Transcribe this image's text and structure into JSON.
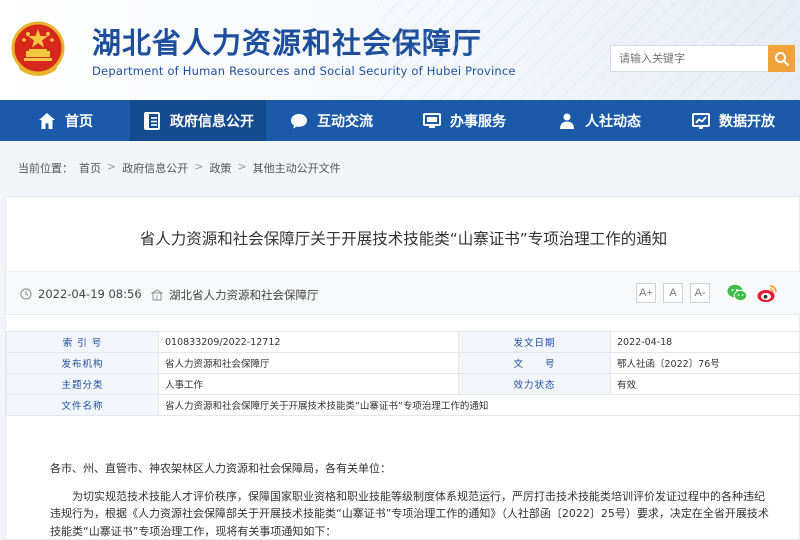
{
  "header": {
    "title": "湖北省人力资源和社会保障厅",
    "subtitle": "Department of Human Resources and Social Security of Hubei Province",
    "search_placeholder": "请输入关键字"
  },
  "nav": [
    {
      "label": "首页",
      "icon": "home-icon"
    },
    {
      "label": "政府信息公开",
      "icon": "document-icon"
    },
    {
      "label": "互动交流",
      "icon": "chat-icon"
    },
    {
      "label": "办事服务",
      "icon": "monitor-icon"
    },
    {
      "label": "人社动态",
      "icon": "person-icon"
    },
    {
      "label": "数据开放",
      "icon": "chart-icon"
    }
  ],
  "nav_active": 1,
  "breadcrumb": {
    "prefix": "当前位置：",
    "items": [
      "首页",
      "政府信息公开",
      "政策",
      "其他主动公开文件"
    ]
  },
  "article": {
    "title": "省人力资源和社会保障厅关于开展技术技能类“山寨证书”专项治理工作的通知",
    "date": "2022-04-19 08:56",
    "source": "湖北省人力资源和社会保障厅",
    "font_buttons": [
      "A+",
      "A",
      "A-"
    ]
  },
  "info": {
    "index_label": "索 引 号",
    "index_value": "010833209/2022-12712",
    "pub_date_label": "发文日期",
    "pub_date_value": "2022-04-18",
    "issuer_label": "发布机构",
    "issuer_value": "省人力资源和社会保障厅",
    "doc_no_label": "文　　号",
    "doc_no_value": "鄂人社函〔2022〕76号",
    "topic_label": "主题分类",
    "topic_value": "人事工作",
    "status_label": "效力状态",
    "status_value": "有效",
    "name_label": "文件名称",
    "name_value": "省人力资源和社会保障厅关于开展技术技能类“山寨证书”专项治理工作的通知"
  },
  "body": {
    "greeting": "各市、州、直管市、神农架林区人力资源和社会保障局，各有关单位：",
    "para1": "为切实规范技术技能人才评价秩序，保障国家职业资格和职业技能等级制度体系规范运行，严厉打击技术技能类培训评价发证过程中的各种违纪违规行为，根据《人力资源社会保障部关于开展技术技能类“山寨证书”专项治理工作的通知》（人社部函〔2022〕25号）要求，决定在全省开展技术技能类“山寨证书”专项治理工作，现将有关事项通知如下："
  },
  "colors": {
    "brand_blue": "#1a5aa8",
    "nav_active": "#154b8f",
    "search_button": "#f0a33a",
    "wechat": "#3ebd4a",
    "weibo": "#e6162d"
  }
}
